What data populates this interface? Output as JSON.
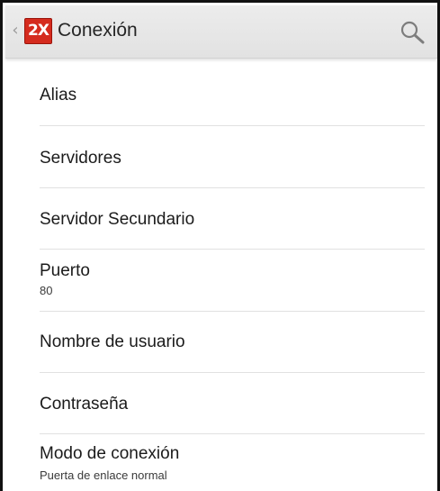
{
  "actionbar": {
    "back_glyph": "‹",
    "logo_text": "2X",
    "title": "Conexión",
    "back_icon": "chevron-left-icon",
    "search_icon": "search-icon"
  },
  "settings": {
    "items": [
      {
        "label": "Alias",
        "summary": ""
      },
      {
        "label": "Servidores",
        "summary": ""
      },
      {
        "label": "Servidor Secundario",
        "summary": ""
      },
      {
        "label": "Puerto",
        "summary": "80"
      },
      {
        "label": "Nombre de usuario",
        "summary": ""
      },
      {
        "label": "Contraseña",
        "summary": ""
      },
      {
        "label": "Modo de conexión",
        "summary": "Puerta de enlace normal"
      }
    ]
  },
  "colors": {
    "actionbar_bg": "#e6e6e6",
    "logo_red": "#d52b1e",
    "divider": "#e1e1e1"
  }
}
